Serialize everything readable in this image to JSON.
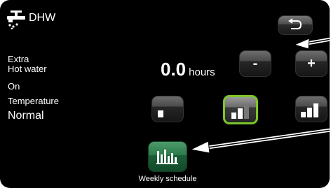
{
  "header": {
    "title": "DHW",
    "icon": "faucet-icon"
  },
  "extra": {
    "label_line1": "Extra",
    "label_line2": "Hot water",
    "status": "On",
    "value": "0.0",
    "unit": "hours",
    "minus_label": "-",
    "plus_label": "+"
  },
  "temperature": {
    "label": "Temperature",
    "value": "Normal",
    "levels": [
      "low",
      "normal",
      "high"
    ],
    "selected_level": "normal"
  },
  "weekly": {
    "label": "Weekly schedule",
    "icon": "weekly-schedule-icon"
  },
  "back": {
    "icon": "back-arrow-icon"
  },
  "colors": {
    "background": "#000000",
    "accent": "#7bc62a",
    "weekly_button": "#2c7a4a"
  }
}
